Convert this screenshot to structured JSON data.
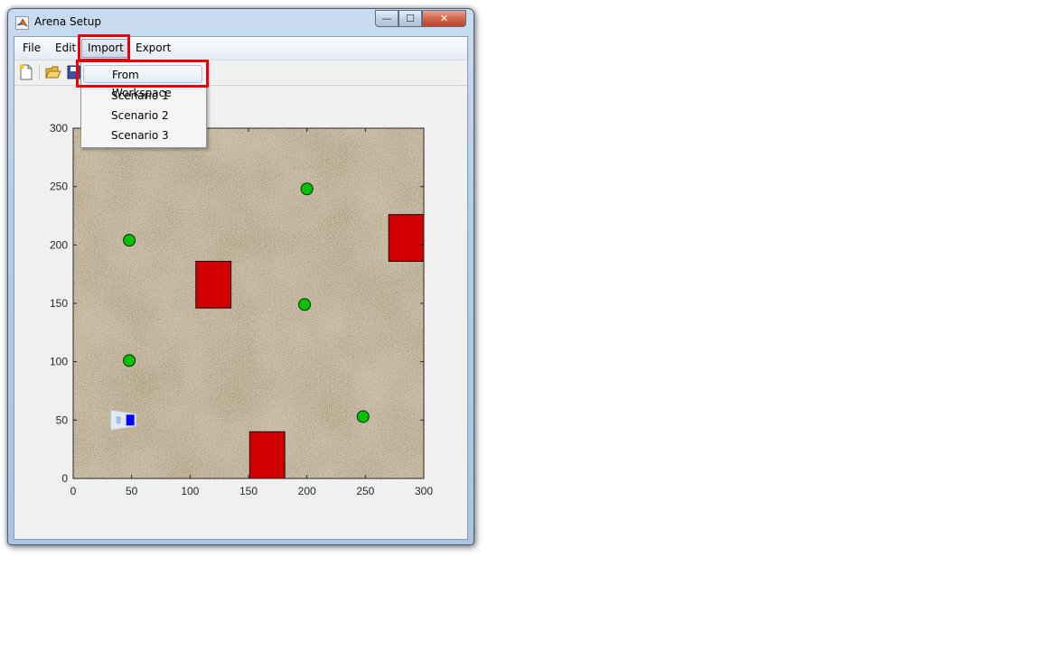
{
  "window": {
    "title": "Arena Setup",
    "buttons": {
      "minimize": "—",
      "maximize": "☐",
      "close": "✕"
    }
  },
  "menubar": {
    "items": [
      "File",
      "Edit",
      "Import",
      "Export"
    ],
    "open_item": "Import"
  },
  "toolbar": {
    "icons": [
      "new-document-icon",
      "open-folder-icon",
      "save-icon"
    ]
  },
  "import_menu": {
    "items": [
      "From Workspace",
      "Scenario 1",
      "Scenario 2",
      "Scenario 3"
    ],
    "highlighted": "From Workspace"
  },
  "colors": {
    "obstacle": "#d00000",
    "target": "#00c000",
    "highlight_box": "#e8000b",
    "robot": "#0000ff"
  },
  "chart_data": {
    "type": "scatter",
    "title": "",
    "xlabel": "",
    "ylabel": "",
    "xlim": [
      0,
      300
    ],
    "ylim": [
      0,
      300
    ],
    "xticks": [
      0,
      50,
      100,
      150,
      200,
      250,
      300
    ],
    "yticks": [
      0,
      50,
      100,
      150,
      200,
      250,
      300
    ],
    "background": "sand-texture",
    "series": [
      {
        "kind": "circle",
        "points": [
          [
            200,
            248
          ],
          [
            48,
            204
          ],
          [
            198,
            149
          ],
          [
            48,
            101
          ],
          [
            248,
            53
          ]
        ]
      },
      {
        "kind": "rectangle",
        "rects": [
          [
            105,
            146,
            30,
            40
          ],
          [
            270,
            186,
            30,
            40
          ],
          [
            151,
            0,
            30,
            40
          ]
        ]
      },
      {
        "kind": "robot",
        "position": [
          50,
          50
        ],
        "heading_deg": 0
      }
    ]
  }
}
